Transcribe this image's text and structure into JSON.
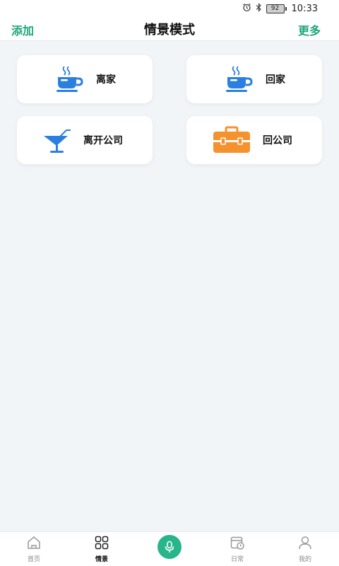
{
  "status_bar": {
    "battery": "92",
    "time": "10:33"
  },
  "header": {
    "left_action": "添加",
    "title": "情景模式",
    "right_action": "更多"
  },
  "scenes": [
    {
      "label": "离家",
      "icon": "coffee-cup-icon"
    },
    {
      "label": "回家",
      "icon": "coffee-cup-icon"
    },
    {
      "label": "离开公司",
      "icon": "cocktail-glass-icon"
    },
    {
      "label": "回公司",
      "icon": "briefcase-icon"
    }
  ],
  "nav": [
    {
      "label": "首页",
      "icon": "home-icon"
    },
    {
      "label": "情景",
      "icon": "grid-icon"
    },
    {
      "label": "",
      "icon": "microphone-icon"
    },
    {
      "label": "日常",
      "icon": "calendar-clock-icon"
    },
    {
      "label": "我的",
      "icon": "user-icon"
    }
  ],
  "colors": {
    "accent_green": "#20a67c",
    "mic_green": "#28b58a",
    "icon_blue": "#2b7fe0",
    "briefcase_orange": "#f5922e",
    "background": "#f2f5f8"
  }
}
